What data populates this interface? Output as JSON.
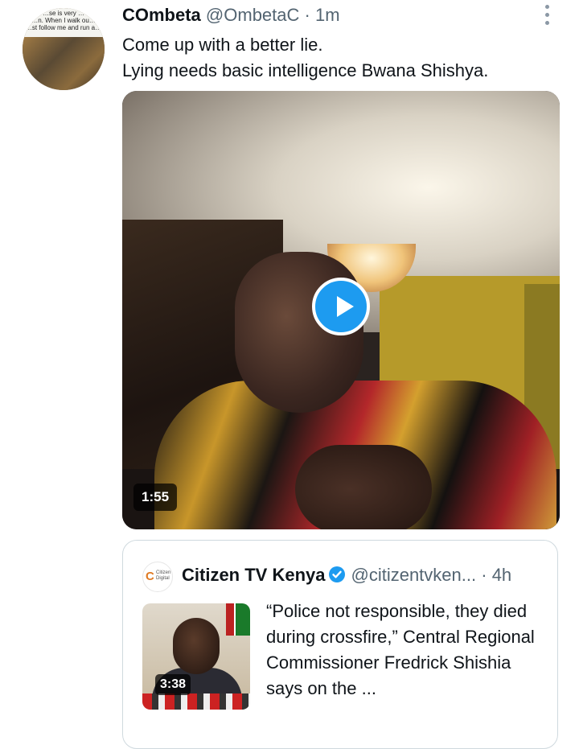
{
  "tweet": {
    "display_name": "COmbeta",
    "handle": "@OmbetaC",
    "separator": "·",
    "time": "1m",
    "more_icon": "more-options-icon",
    "text_line1": "Come up with a better lie.",
    "text_line2": "Lying needs basic intelligence Bwana Shishya.",
    "avatar_caption": "…se is very …\n…n. When I walk ou…\n…st follow me and run a…"
  },
  "media": {
    "duration": "1:55",
    "play_icon": "play-icon",
    "accent": "#1d9bf0"
  },
  "quoted_tweet": {
    "logo_mark": "C",
    "logo_text": "Citizen\nDigital",
    "display_name": "Citizen TV Kenya",
    "verified_icon": "verified-badge-icon",
    "handle": "@citizentvken...",
    "separator": "·",
    "time": "4h",
    "thumb_duration": "3:38",
    "text": "“Police not responsible, they died during crossfire,” Central Regional Commissioner Fredrick Shishia says on the ..."
  },
  "colors": {
    "text_primary": "#0f1419",
    "text_secondary": "#536471",
    "border": "#cfd9de",
    "verified": "#1d9bf0"
  }
}
